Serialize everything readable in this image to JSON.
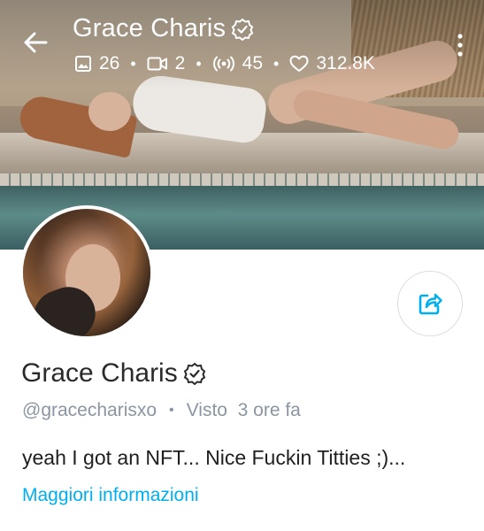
{
  "header": {
    "title": "Grace Charis",
    "stats": {
      "photos": "26",
      "videos": "2",
      "streams": "45",
      "likes": "312.8K"
    }
  },
  "profile": {
    "name": "Grace Charis",
    "handle": "@gracecharisxo",
    "last_seen": "Visto  3 ore fa",
    "bio": "yeah I got an NFT... Nice Fuckin Titties ;)...",
    "more_link": "Maggiori informazioni"
  },
  "icons": {
    "back": "arrow-left-icon",
    "verified": "verified-badge-icon",
    "photos": "image-icon",
    "videos": "video-icon",
    "streams": "broadcast-icon",
    "likes": "heart-icon",
    "menu": "more-vertical-icon",
    "share": "share-icon"
  },
  "colors": {
    "accent": "#00aff0",
    "text_primary": "#2a2a2a",
    "text_secondary": "#8a96a3"
  }
}
